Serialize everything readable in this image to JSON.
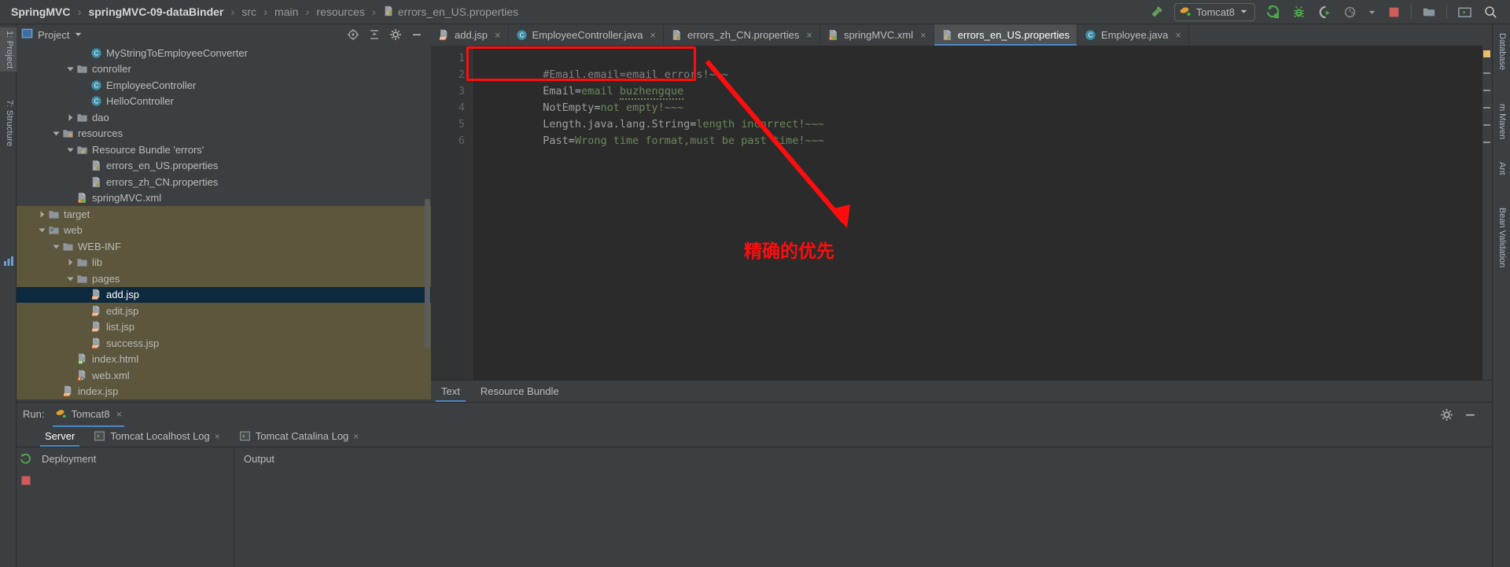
{
  "breadcrumb": {
    "items": [
      {
        "label": "SpringMVC",
        "bold": true
      },
      {
        "label": "springMVC-09-dataBinder",
        "bold": true
      },
      {
        "label": "src",
        "bold": false
      },
      {
        "label": "main",
        "bold": false
      },
      {
        "label": "resources",
        "bold": false
      },
      {
        "label": "errors_en_US.properties",
        "bold": false,
        "icon": "properties-file-icon"
      }
    ],
    "separator": "›"
  },
  "toolbar": {
    "build_icon": "build-hammer-icon",
    "run_config_label": "Tomcat8",
    "run_config_icon": "tomcat-cat-icon",
    "dropdown_icon": "chevron-down-icon",
    "run_icon": "run-icon",
    "debug_icon": "debug-bug-icon",
    "run_coverage_icon": "run-with-coverage-icon",
    "profile_icon": "profile-icon",
    "profile_dropdown_icon": "chevron-down-icon",
    "stop_icon": "stop-icon",
    "project_structure_icon": "project-structure-icon",
    "terminal_icon": "terminal-icon",
    "search_icon": "search-icon"
  },
  "left_strip": {
    "project_label": "1: Project",
    "structure_label": "7: Structure",
    "favorites_icon": "favorites-icon"
  },
  "right_strip": {
    "items": [
      {
        "label": "Database"
      },
      {
        "label": "m Maven"
      },
      {
        "label": "Ant"
      },
      {
        "label": "Bean Validation"
      }
    ]
  },
  "project_panel": {
    "title": "Project",
    "title_dropdown_icon": "chevron-down-icon",
    "header_icons": [
      "locate-icon",
      "collapse-all-icon",
      "settings-gear-icon",
      "hide-icon"
    ],
    "tree": [
      {
        "label": "MyStringToEmployeeConverter",
        "depth": 5,
        "icon": "java-class-icon",
        "twisty": "none",
        "state": "normal"
      },
      {
        "label": "conroller",
        "depth": 4,
        "icon": "package-folder-icon",
        "twisty": "open",
        "state": "normal"
      },
      {
        "label": "EmployeeController",
        "depth": 5,
        "icon": "java-class-icon",
        "twisty": "none",
        "state": "normal"
      },
      {
        "label": "HelloController",
        "depth": 5,
        "icon": "java-class-icon",
        "twisty": "none",
        "state": "normal"
      },
      {
        "label": "dao",
        "depth": 4,
        "icon": "package-folder-icon",
        "twisty": "closed",
        "state": "normal"
      },
      {
        "label": "resources",
        "depth": 3,
        "icon": "resources-folder-icon",
        "twisty": "open",
        "state": "normal"
      },
      {
        "label": "Resource Bundle 'errors'",
        "depth": 4,
        "icon": "resource-bundle-icon",
        "twisty": "open",
        "state": "normal"
      },
      {
        "label": "errors_en_US.properties",
        "depth": 5,
        "icon": "properties-file-icon",
        "twisty": "none",
        "state": "normal"
      },
      {
        "label": "errors_zh_CN.properties",
        "depth": 5,
        "icon": "properties-file-icon",
        "twisty": "none",
        "state": "normal"
      },
      {
        "label": "springMVC.xml",
        "depth": 4,
        "icon": "spring-xml-icon",
        "twisty": "none",
        "state": "normal"
      },
      {
        "label": "target",
        "depth": 2,
        "icon": "folder-icon",
        "twisty": "closed",
        "state": "match"
      },
      {
        "label": "web",
        "depth": 2,
        "icon": "web-module-folder-icon",
        "twisty": "open",
        "state": "match"
      },
      {
        "label": "WEB-INF",
        "depth": 3,
        "icon": "folder-icon",
        "twisty": "open",
        "state": "match"
      },
      {
        "label": "lib",
        "depth": 4,
        "icon": "folder-icon",
        "twisty": "closed",
        "state": "match"
      },
      {
        "label": "pages",
        "depth": 4,
        "icon": "folder-icon",
        "twisty": "open",
        "state": "match"
      },
      {
        "label": "add.jsp",
        "depth": 5,
        "icon": "jsp-file-icon",
        "twisty": "none",
        "state": "selected"
      },
      {
        "label": "edit.jsp",
        "depth": 5,
        "icon": "jsp-file-icon",
        "twisty": "none",
        "state": "match"
      },
      {
        "label": "list.jsp",
        "depth": 5,
        "icon": "jsp-file-icon",
        "twisty": "none",
        "state": "match"
      },
      {
        "label": "success.jsp",
        "depth": 5,
        "icon": "jsp-file-icon",
        "twisty": "none",
        "state": "match"
      },
      {
        "label": "index.html",
        "depth": 4,
        "icon": "html-file-icon",
        "twisty": "none",
        "state": "match"
      },
      {
        "label": "web.xml",
        "depth": 4,
        "icon": "web-xml-icon",
        "twisty": "none",
        "state": "match"
      },
      {
        "label": "index.jsp",
        "depth": 3,
        "icon": "jsp-file-icon",
        "twisty": "none",
        "state": "match"
      }
    ]
  },
  "editor": {
    "tabs": [
      {
        "label": "add.jsp",
        "icon": "jsp-file-icon",
        "active": false,
        "closable": true
      },
      {
        "label": "EmployeeController.java",
        "icon": "java-class-icon",
        "active": false,
        "closable": true
      },
      {
        "label": "errors_zh_CN.properties",
        "icon": "properties-file-icon",
        "active": false,
        "closable": true
      },
      {
        "label": "springMVC.xml",
        "icon": "spring-xml-icon",
        "active": false,
        "closable": true
      },
      {
        "label": "errors_en_US.properties",
        "icon": "properties-file-icon",
        "active": true,
        "closable": false
      },
      {
        "label": "Employee.java",
        "icon": "java-class-icon",
        "active": false,
        "closable": true
      }
    ],
    "close_glyph": "×",
    "line_numbers": [
      "1",
      "2",
      "3",
      "4",
      "5",
      "6"
    ],
    "lines": [
      {
        "n": "1",
        "type": "comment",
        "text": "#Email.email=email errors!~~~"
      },
      {
        "n": "2",
        "type": "pair",
        "key": "Email",
        "value": "email ",
        "squiggle": "buzhengque"
      },
      {
        "n": "3",
        "type": "pair",
        "key": "NotEmpty",
        "value": "not empty!~~~",
        "squiggle": ""
      },
      {
        "n": "4",
        "type": "pair",
        "key": "Length.java.lang.String",
        "value": "length incorrect!~~~",
        "squiggle": ""
      },
      {
        "n": "5",
        "type": "pair",
        "key": "Past",
        "value": "Wrong time format,must be past time!~~~",
        "squiggle": ""
      },
      {
        "n": "6",
        "type": "empty",
        "text": ""
      }
    ],
    "annotation_text": "精确的优先",
    "annotation_color": "#fd0d0d",
    "footer_tabs": [
      {
        "label": "Text",
        "active": true
      },
      {
        "label": "Resource Bundle",
        "active": false
      }
    ]
  },
  "run_panel": {
    "label": "Run:",
    "config_name": "Tomcat8",
    "config_icon": "tomcat-cat-icon",
    "close_glyph": "×",
    "header_icons": [
      "settings-gear-icon",
      "hide-panel-icon"
    ],
    "tabs": [
      {
        "label": "Server",
        "icon": "",
        "active": true,
        "closable": false
      },
      {
        "label": "Tomcat Localhost Log",
        "icon": "log-output-icon",
        "active": false,
        "closable": true
      },
      {
        "label": "Tomcat Catalina Log",
        "icon": "log-output-icon",
        "active": false,
        "closable": true
      }
    ],
    "left_icons": [
      "rerun-icon",
      "stop-icon"
    ],
    "columns": [
      {
        "title": "Deployment"
      },
      {
        "title": "Output"
      }
    ]
  },
  "colors": {
    "accent": "#4a88c7",
    "annotation": "#fd0d0d",
    "selection": "#0d293e",
    "match": "#5b563c",
    "editor_bg": "#2b2b2b",
    "panel_bg": "#3c3f41",
    "string_green": "#6a8759",
    "comment_grey": "#808080"
  }
}
